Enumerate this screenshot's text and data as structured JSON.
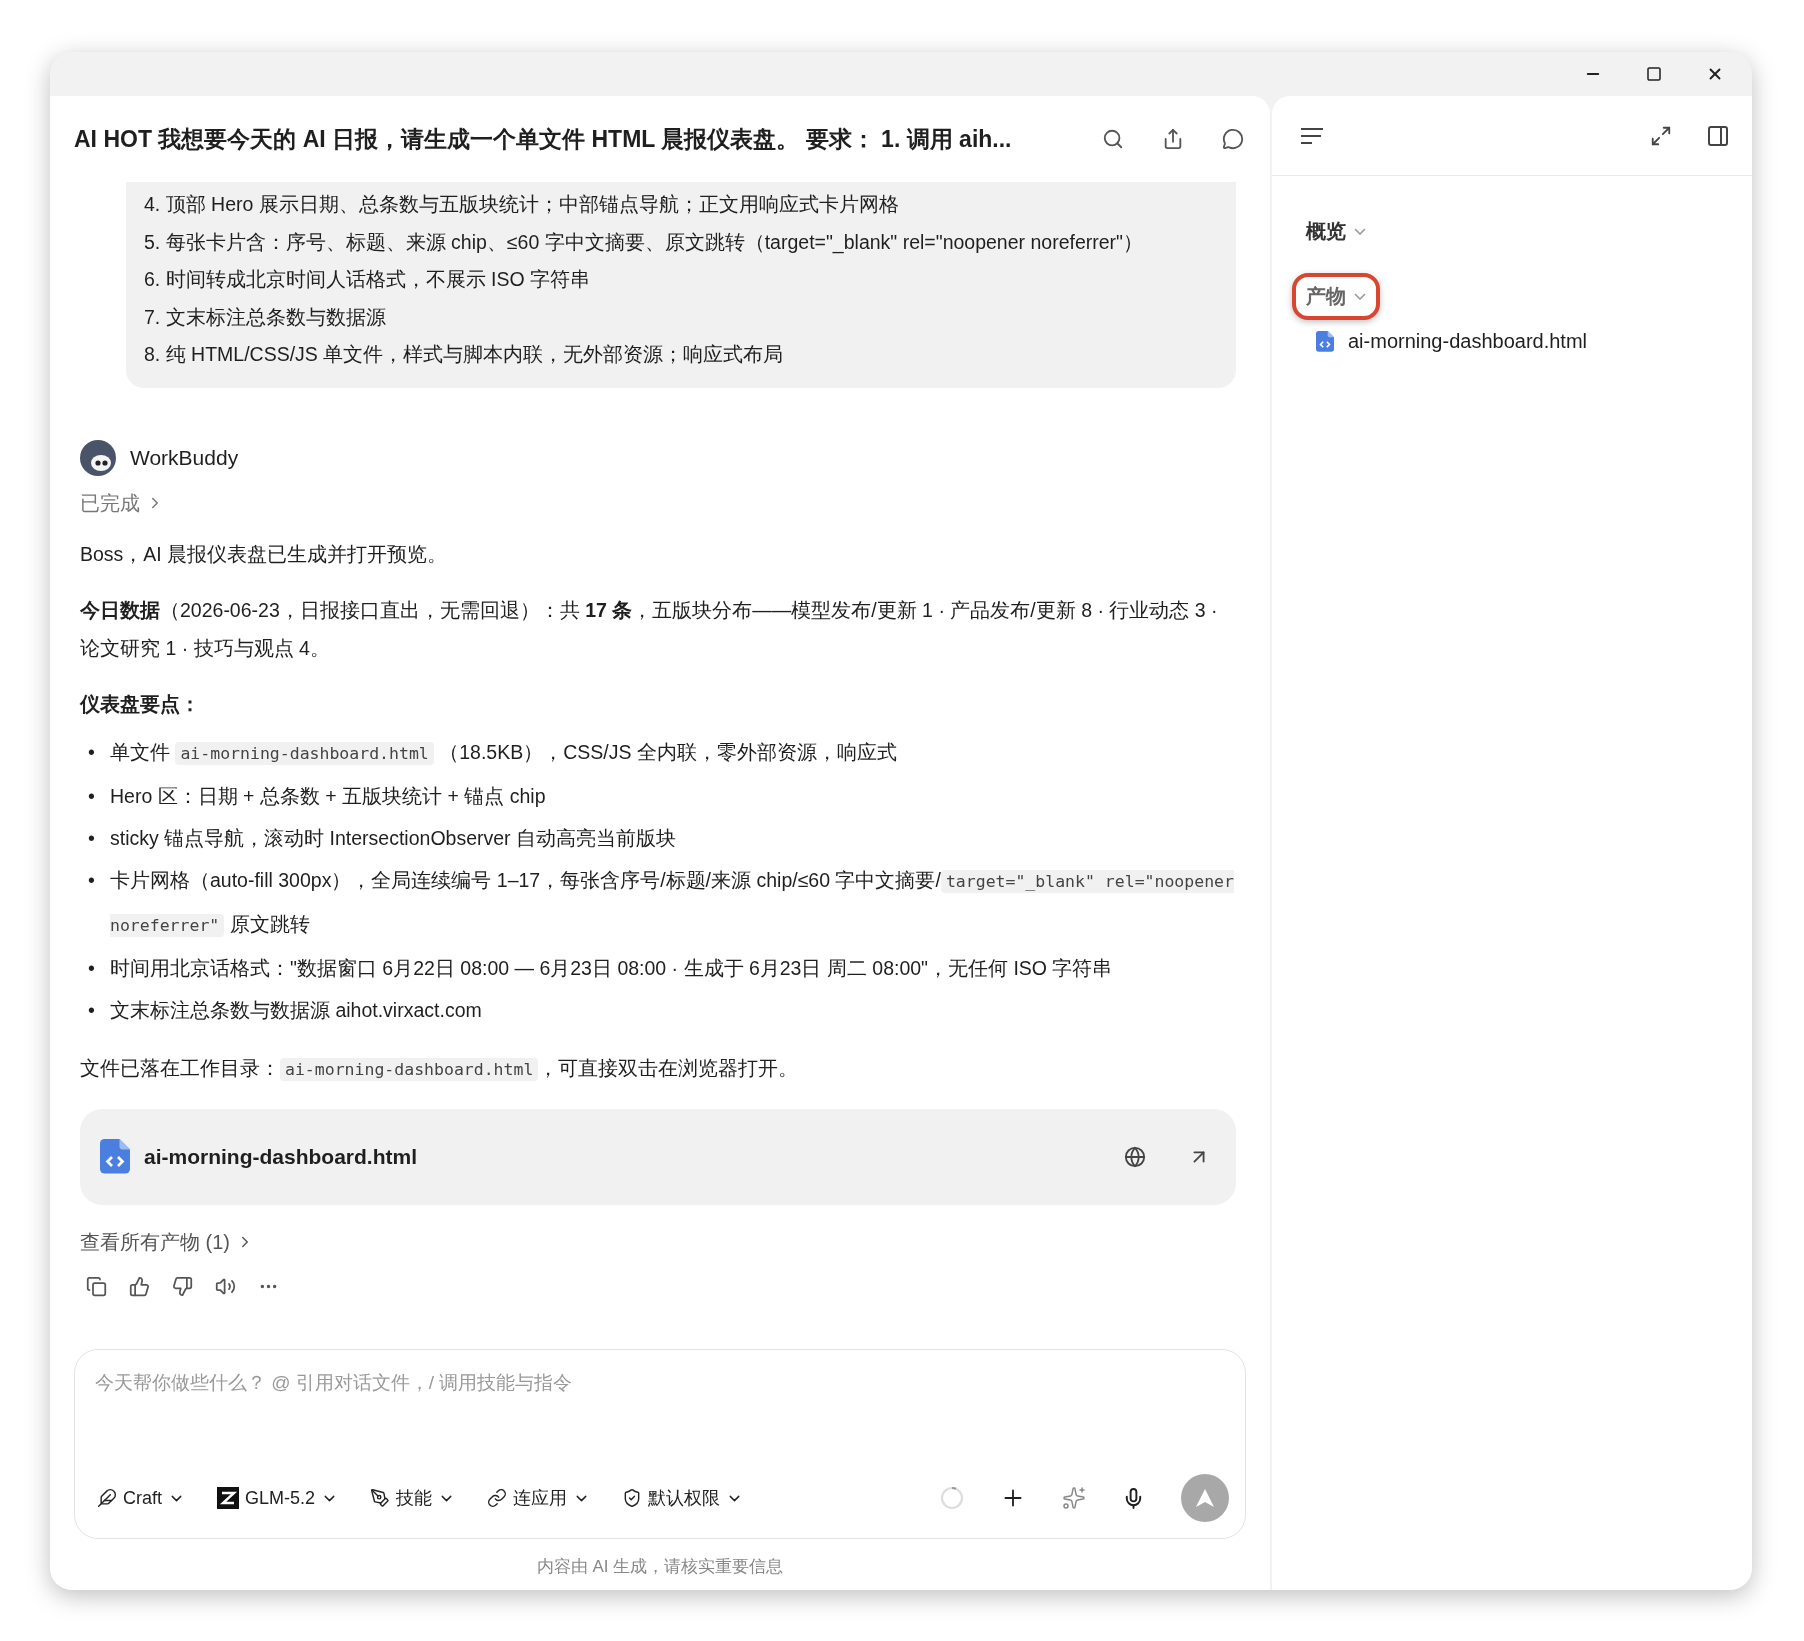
{
  "window": {
    "title": "AI HOT 我想要今天的 AI 日报，请生成一个单文件 HTML 晨报仪表盘。 要求： 1. 调用 aih..."
  },
  "request": {
    "lines": [
      "4. 顶部 Hero 展示日期、总条数与五版块统计；中部锚点导航；正文用响应式卡片网格",
      "5. 每张卡片含：序号、标题、来源 chip、≤60 字中文摘要、原文跳转（target=\"_blank\" rel=\"noopener noreferrer\"）",
      "6. 时间转成北京时间人话格式，不展示 ISO 字符串",
      "7. 文末标注总条数与数据源",
      "8. 纯 HTML/CSS/JS 单文件，样式与脚本内联，无外部资源；响应式布局"
    ]
  },
  "reply": {
    "author": "WorkBuddy",
    "status": "已完成",
    "blocks": [
      {
        "kind": "paragraph",
        "segments": [
          {
            "kind": "text",
            "text": "Boss，AI 晨报仪表盘已生成并打开预览。"
          }
        ]
      },
      {
        "kind": "paragraph",
        "segments": [
          {
            "kind": "text",
            "text": "**今日数据**（2026-06-23，日报接口直出，无需回退）：共 **17 条**，五版块分布——模型发布/更新 1 · 产品发布/更新 8 · 行业动态 3 · 论文研究 1 · 技巧与观点 4。"
          }
        ]
      },
      {
        "kind": "heading",
        "text": "仪表盘要点："
      },
      {
        "kind": "list",
        "items": [
          {
            "marker": "•",
            "segments": [
              {
                "kind": "text",
                "text": "单文件 "
              },
              {
                "kind": "code",
                "text": "ai-morning-dashboard.html"
              },
              {
                "kind": "text",
                "text": " （18.5KB），CSS/JS 全内联，零外部资源，响应式"
              }
            ]
          },
          {
            "marker": "•",
            "segments": [
              {
                "kind": "text",
                "text": "Hero 区：日期 + 总条数 + 五版块统计 + 锚点 chip"
              }
            ]
          },
          {
            "marker": "•",
            "segments": [
              {
                "kind": "text",
                "text": "sticky 锚点导航，滚动时 IntersectionObserver 自动高亮当前版块"
              }
            ]
          },
          {
            "marker": "•",
            "segments": [
              {
                "kind": "text",
                "text": "卡片网格（auto-fill 300px），全局连续编号 1–17，每张含序号/标题/来源 chip/≤60 字中文摘要/"
              },
              {
                "kind": "code",
                "text": "target=\"_blank\" rel=\"noopener noreferrer\""
              },
              {
                "kind": "text",
                "text": " 原文跳转"
              }
            ]
          },
          {
            "marker": "•",
            "segments": [
              {
                "kind": "text",
                "text": "时间用北京话格式：\"数据窗口 6月22日 08:00 — 6月23日 08:00 · 生成于 6月23日 周二 08:00\"，无任何 ISO 字符串"
              }
            ]
          },
          {
            "marker": "•",
            "segments": [
              {
                "kind": "text",
                "text": "文末标注总条数与数据源 aihot.virxact.com"
              }
            ]
          }
        ]
      },
      {
        "kind": "paragraph",
        "segments": [
          {
            "kind": "text",
            "text": "文件已落在工作目录："
          },
          {
            "kind": "code",
            "text": "ai-morning-dashboard.html"
          },
          {
            "kind": "text",
            "text": "，可直接双击在浏览器打开。"
          }
        ]
      }
    ],
    "file_card": {
      "name": "ai-morning-dashboard.html"
    },
    "artifacts_link": "查看所有产物 (1)"
  },
  "composer": {
    "placeholder": "今天帮你做些什么？ @ 引用对话文件，/ 调用技能与指令",
    "tools": [
      {
        "kind": "mode",
        "label": "Craft"
      },
      {
        "kind": "model",
        "label": "GLM-5.2"
      },
      {
        "kind": "skills",
        "label": "技能"
      },
      {
        "kind": "apps",
        "label": "连应用"
      },
      {
        "kind": "permission",
        "label": "默认权限"
      }
    ]
  },
  "disclaimer": "内容由 AI 生成，请核实重要信息",
  "side_panel": {
    "sections": [
      {
        "title": "概览",
        "highlighted": false
      },
      {
        "title": "产物",
        "highlighted": true,
        "files": [
          "ai-morning-dashboard.html"
        ]
      }
    ]
  }
}
